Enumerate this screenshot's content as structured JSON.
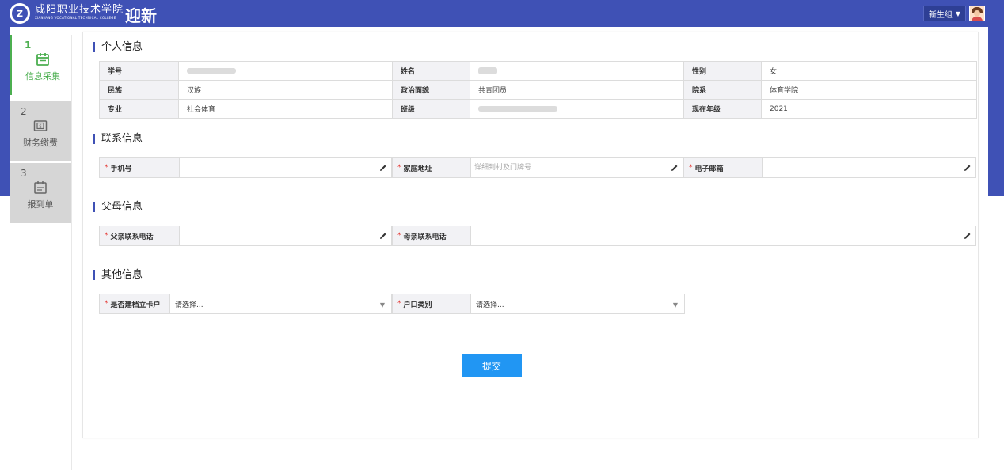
{
  "header": {
    "school_cn": "咸阳职业技术学院",
    "school_en": "XIANYANG VOCATIONAL TECHNICAL COLLEGE",
    "app_title": "迎新",
    "user_group": "新生组"
  },
  "steps": [
    {
      "num": "1",
      "label": "信息采集",
      "icon": "calendar-icon",
      "active": true
    },
    {
      "num": "2",
      "label": "财务缴费",
      "icon": "dollar-icon",
      "active": false
    },
    {
      "num": "3",
      "label": "报到单",
      "icon": "document-icon",
      "active": false
    }
  ],
  "sections": {
    "personal": "个人信息",
    "contact": "联系信息",
    "parents": "父母信息",
    "other": "其他信息"
  },
  "personal": {
    "student_id_label": "学号",
    "name_label": "姓名",
    "gender_label": "性别",
    "gender": "女",
    "ethnicity_label": "民族",
    "ethnicity": "汉族",
    "political_label": "政治面貌",
    "political": "共青团员",
    "department_label": "院系",
    "department": "体育学院",
    "major_label": "专业",
    "major": "社会体育",
    "class_label": "班级",
    "grade_label": "现在年级",
    "grade": "2021"
  },
  "contact": {
    "phone_label": "手机号",
    "address_label": "家庭地址",
    "address_placeholder": "详细到村及门牌号",
    "email_label": "电子邮箱"
  },
  "parents": {
    "father_label": "父亲联系电话",
    "mother_label": "母亲联系电话"
  },
  "other": {
    "card_label": "是否建档立卡户",
    "card_value": "请选择...",
    "hukou_label": "户口类别",
    "hukou_value": "请选择..."
  },
  "submit_label": "提交",
  "colors": {
    "header_blue": "#3f51b5",
    "active_green": "#4caf50",
    "submit_blue": "#2196f3"
  }
}
